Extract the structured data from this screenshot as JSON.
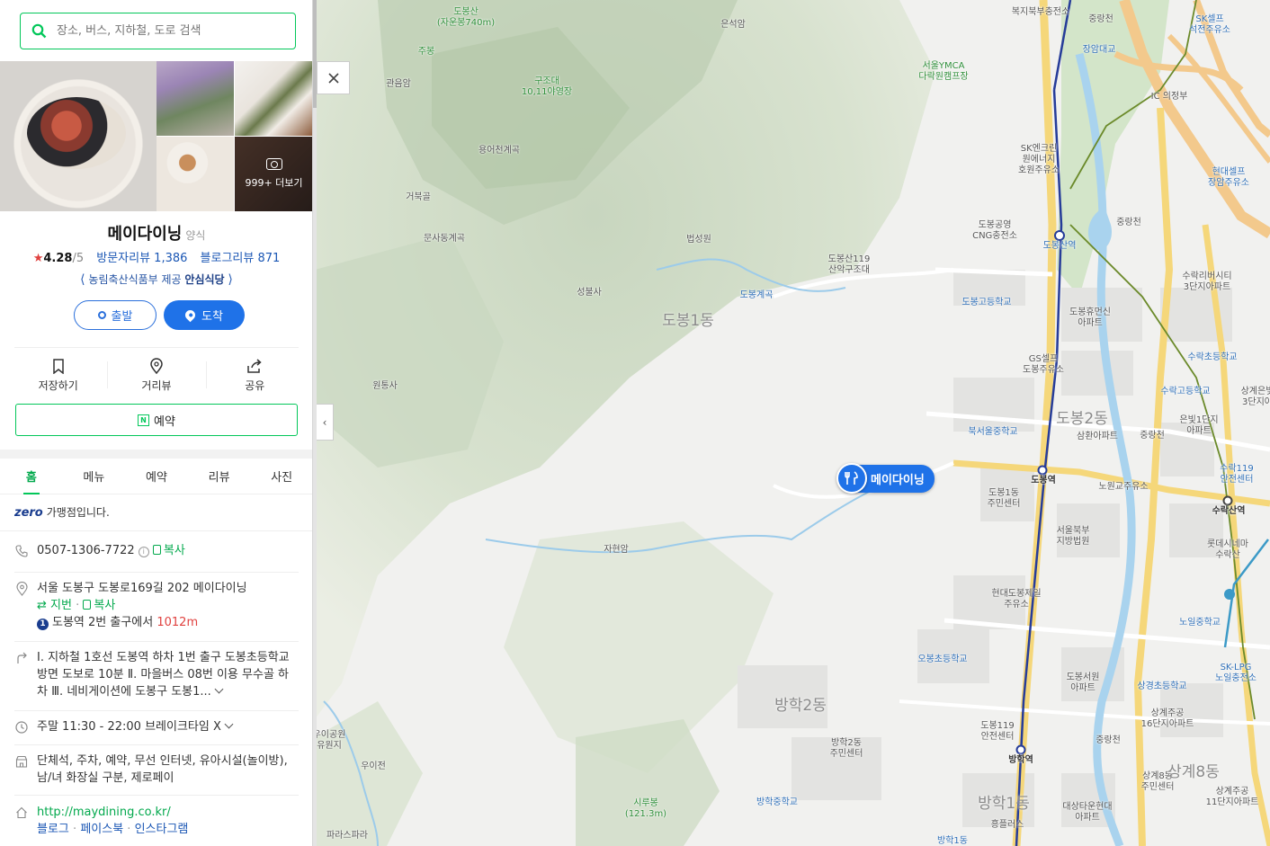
{
  "search": {
    "placeholder": "장소, 버스, 지하철, 도로 검색"
  },
  "photos": {
    "more_label": "999+ 더보기"
  },
  "place": {
    "name": "메이다이닝",
    "category": "양식",
    "rating": "4.28",
    "rating_max": "/5",
    "visitor_reviews": "방문자리뷰 1,386",
    "blog_reviews": "블로그리뷰 871",
    "cert_provider": "농림축산식품부 제공",
    "cert_name": "안심식당"
  },
  "buttons": {
    "start": "출발",
    "arrive": "도착",
    "save": "저장하기",
    "street_view": "거리뷰",
    "share": "공유",
    "reserve": "예약"
  },
  "tabs": [
    "홈",
    "메뉴",
    "예약",
    "리뷰",
    "사진"
  ],
  "zero": {
    "logo": "zero",
    "text": "가맹점입니다."
  },
  "info": {
    "phone": "0507-1306-7722",
    "copy": "복사",
    "address": "서울 도봉구 도봉로169길 202 메이다이닝",
    "jibun": "지번",
    "subway_line": "1",
    "subway_text": "도봉역 2번 출구에서",
    "subway_distance": "1012m",
    "directions": "Ⅰ. 지하철 1호선 도봉역 하차 1번 출구 도봉초등학교 방면 도보로 10분 Ⅱ. 마을버스 08번 이용 무수골 하차 Ⅲ. 네비게이션에 도봉구 도봉1...",
    "hours": "주말 11:30 - 22:00 브레이크타임 X",
    "amenities": "단체석, 주차, 예약, 무선 인터넷, 유아시설(놀이방), 남/녀 화장실 구분, 제로페이",
    "website": "http://maydining.co.kr/",
    "sns": [
      "블로그",
      "페이스북",
      "인스타그램"
    ]
  },
  "map": {
    "marker_label": "메이다이닝",
    "labels": [
      "도봉산\n(자운봉740m)",
      "은석암",
      "주봉",
      "관음암",
      "구조대\n10,11야영장",
      "용어천계곡",
      "거북골",
      "문사동계곡",
      "법성원",
      "성불사",
      "도봉산119\n산악구조대",
      "도봉계곡",
      "원통사",
      "자현암",
      "서울YMCA\n다락원캠프장",
      "복지북부충전소",
      "중랑천",
      "장암대교",
      "SK셀프\n석전주유소",
      "IC 의정부",
      "SK엔크린\n원에너지\n호원주유소",
      "현대셀프\n장암주유소",
      "도봉공영\nCNG충전소",
      "도봉산역",
      "중랑천",
      "수락리버시티\n3단지아파트",
      "도봉고등학교",
      "도봉휴먼신\n아파트",
      "GS셀프\n도봉주유소",
      "수락초등학교",
      "수락고등학교",
      "상계은빛\n3단지아",
      "북서울중학교",
      "삼환아파트",
      "중랑천",
      "은빛1단지\n아파트",
      "도봉역",
      "노원교주유소",
      "수락119\n안전센터",
      "도봉1동\n주민센터",
      "수락산역",
      "서울북부\n지방법원",
      "롯데시네마\n수락산",
      "현대도봉제일\n주유소",
      "노일중학교",
      "오봉초등학교",
      "SK-LPG\n노일충전소",
      "도봉서원\n아파트",
      "상경초등학교",
      "상계주공\n16단지아파트",
      "도봉119\n안전센터",
      "방학역",
      "중랑천",
      "방학2동\n주민센터",
      "우이전",
      "우이공원\n유원지",
      "상계8동\n주민센터",
      "상계주공\n11단지아파트",
      "시루봉\n(121.3m)",
      "방학중학교",
      "대상타운현대\n아파트",
      "흥플러스",
      "파라스파라",
      "방학1동"
    ],
    "districts": [
      "도봉1동",
      "도봉2동",
      "방학2동",
      "방학1동",
      "상계8동"
    ]
  }
}
